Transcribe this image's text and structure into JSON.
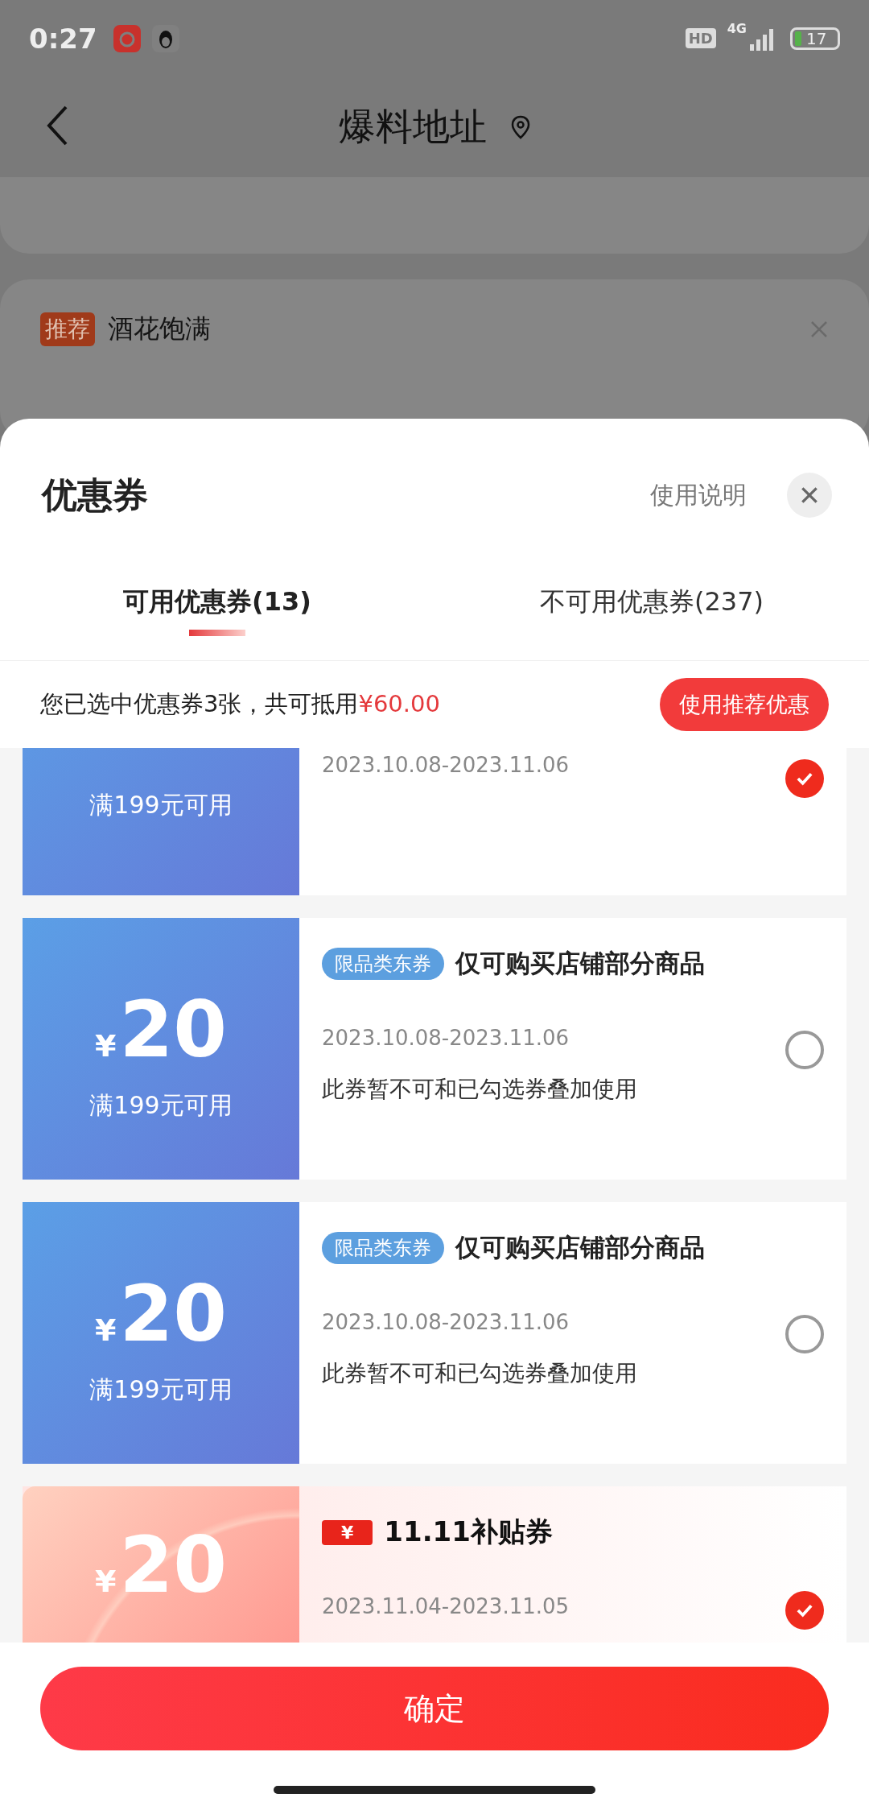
{
  "status_bar": {
    "time": "0:27",
    "hd": "HD",
    "network": "4G",
    "battery": "17"
  },
  "page": {
    "title": "爆料地址",
    "recommend": {
      "tag": "推荐",
      "text": "酒花饱满"
    }
  },
  "sheet": {
    "title": "优惠券",
    "help": "使用说明",
    "tabs": [
      {
        "label": "可用优惠券(13)",
        "selected": true
      },
      {
        "label": "不可用优惠券(237)",
        "selected": false
      }
    ],
    "summary": {
      "text": "您已选中优惠券3张，共可抵用",
      "amount": "¥60.00",
      "button": "使用推荐优惠"
    },
    "coupons": [
      {
        "kind": "blue",
        "condition": "满199元可用",
        "date": "2023.10.08-2023.11.06",
        "selected": true
      },
      {
        "kind": "blue",
        "symbol": "¥",
        "amount": "20",
        "condition": "满199元可用",
        "tag": "限品类东券",
        "title": "仅可购买店铺部分商品",
        "date": "2023.10.08-2023.11.06",
        "note": "此券暂不可和已勾选券叠加使用",
        "selected": false
      },
      {
        "kind": "blue",
        "symbol": "¥",
        "amount": "20",
        "condition": "满199元可用",
        "tag": "限品类东券",
        "title": "仅可购买店铺部分商品",
        "date": "2023.10.08-2023.11.06",
        "note": "此券暂不可和已勾选券叠加使用",
        "selected": false
      },
      {
        "kind": "subsidy",
        "symbol": "¥",
        "amount": "20",
        "badge": "¥",
        "title": "11.11补贴券",
        "date": "2023.11.04-2023.11.05",
        "selected": true
      }
    ],
    "confirm": "确定"
  }
}
